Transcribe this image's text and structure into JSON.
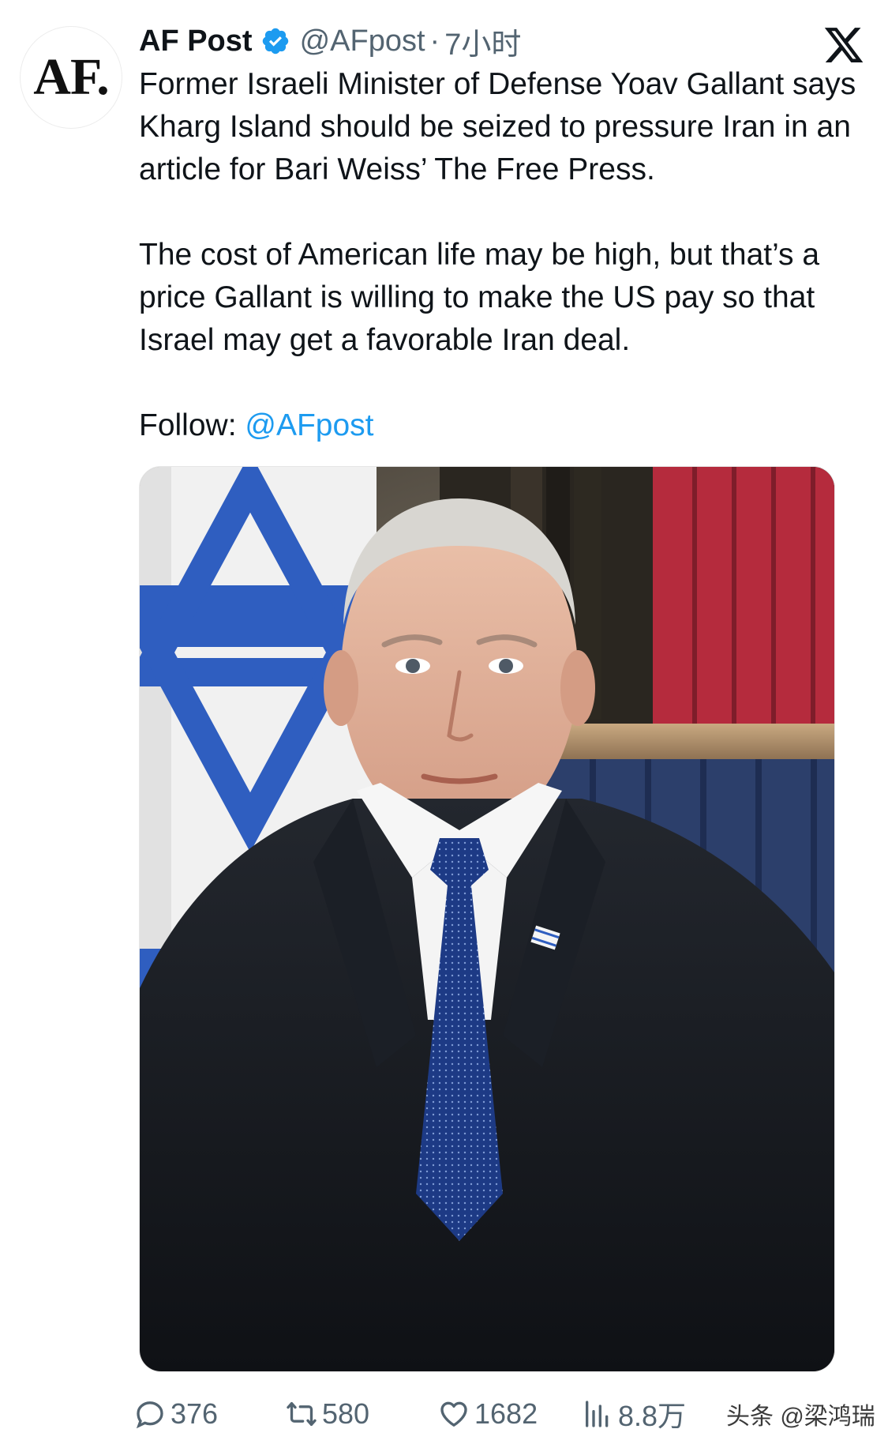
{
  "tweet": {
    "avatar_text": "AF.",
    "display_name": "AF Post",
    "handle": "@AFpost",
    "separator": "·",
    "time": "7小时",
    "paragraph1": "Former Israeli Minister of Defense Yoav Gallant says Kharg Island should be seized to pressure Iran in an article for Bari Weiss’ The Free Press.",
    "paragraph2": "The cost of American life may be high, but that’s a price Gallant is willing to make the US pay so that Israel may get a favorable Iran deal.",
    "follow_label": "Follow: ",
    "follow_mention": "@AFpost"
  },
  "actions": {
    "replies": "376",
    "reposts": "580",
    "likes": "1682",
    "views": "8.8万"
  },
  "watermark": "头条 @梁鸿瑞",
  "icons": [
    "verified-badge-icon",
    "x-logo-icon",
    "reply-icon",
    "repost-icon",
    "like-icon",
    "views-icon"
  ],
  "colors": {
    "accent": "#1d9bf0",
    "secondary_text": "#536471",
    "primary_text": "#0f1419"
  }
}
